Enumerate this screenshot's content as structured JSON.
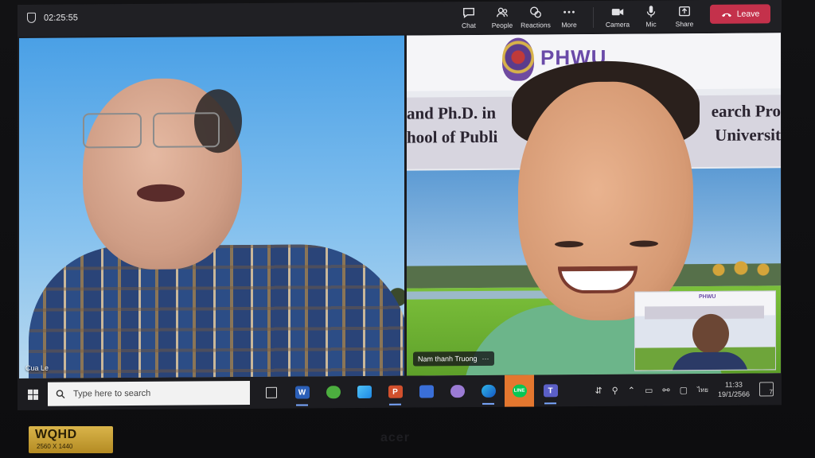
{
  "meeting": {
    "elapsed_time": "02:25:55",
    "toolbar": {
      "chat": "Chat",
      "people": "People",
      "reactions": "Reactions",
      "more": "More",
      "camera": "Camera",
      "mic": "Mic",
      "share": "Share",
      "leave": "Leave"
    },
    "participants": [
      {
        "name": "Cua Le"
      },
      {
        "name": "Nam thanh Truong",
        "menu": "···"
      }
    ],
    "background_slide": {
      "logo_text": "PHWU",
      "line1_left": "and Ph.D. in",
      "line1_right": "earch Pro",
      "line2_left": "hool of Publi",
      "line2_right": "Universit"
    },
    "self_view": {
      "logo_text": "PHWU"
    }
  },
  "taskbar": {
    "search_placeholder": "Type here to search",
    "apps": [
      "task-view",
      "word",
      "android-app",
      "photos",
      "powerpoint",
      "store",
      "maps",
      "edge",
      "line",
      "teams"
    ],
    "time": "11:33",
    "date": "19/1/2566",
    "notifications": "7",
    "lang": "ไทย"
  },
  "monitor": {
    "badge_big": "WQHD",
    "badge_small": "2560 X 1440",
    "brand": "acer"
  },
  "colors": {
    "leave": "#c4314b",
    "teams_bar": "#202024",
    "taskbar": "#1c1c20"
  }
}
